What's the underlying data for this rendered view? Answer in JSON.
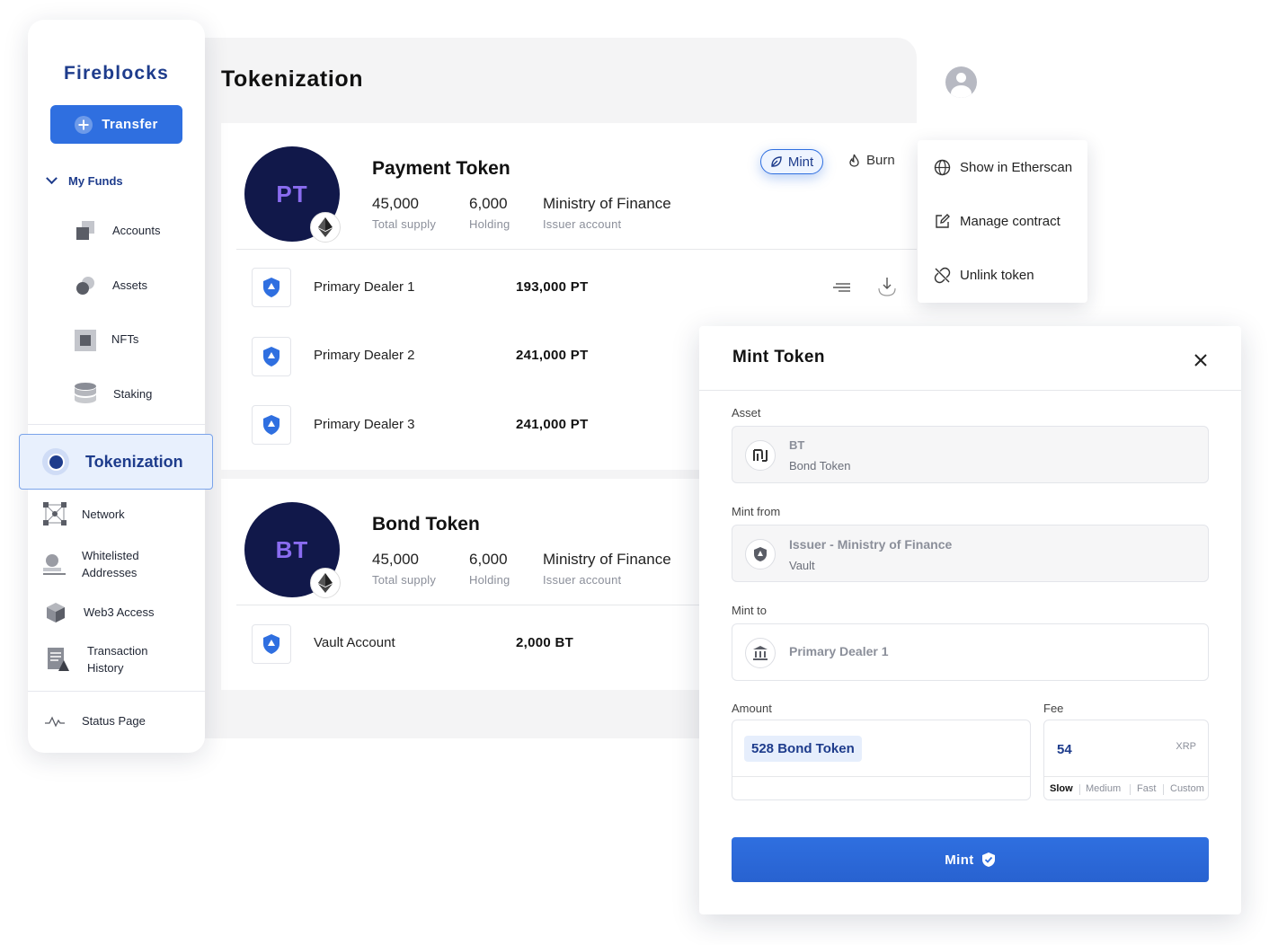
{
  "app": {
    "brand": "Fireblocks"
  },
  "sidebar": {
    "transfer_label": "Transfer",
    "group_label": "My Funds",
    "fund_items": [
      {
        "label": "Accounts",
        "icon": "accounts-icon"
      },
      {
        "label": "Assets",
        "icon": "assets-icon"
      },
      {
        "label": "NFTs",
        "icon": "nfts-icon"
      },
      {
        "label": "Staking",
        "icon": "staking-icon"
      }
    ],
    "active_label": "Tokenization",
    "items": [
      {
        "label": "Network",
        "icon": "network-icon"
      },
      {
        "label": "Whitelisted Addresses",
        "icon": "whitelist-icon"
      },
      {
        "label": "Web3 Access",
        "icon": "web3-icon"
      },
      {
        "label": "Transaction History",
        "icon": "history-icon"
      }
    ],
    "status_label": "Status Page"
  },
  "page": {
    "title": "Tokenization"
  },
  "tokens": [
    {
      "symbol": "PT",
      "name": "Payment Token",
      "total_supply": "45,000",
      "total_supply_label": "Total supply",
      "holding": "6,000",
      "holding_label": "Holding",
      "issuer": "Ministry of Finance",
      "issuer_label": "Issuer account",
      "holders": [
        {
          "name": "Primary Dealer 1",
          "amount": "193,000 PT"
        },
        {
          "name": "Primary Dealer 2",
          "amount": "241,000 PT"
        },
        {
          "name": "Primary Dealer 3",
          "amount": "241,000 PT"
        }
      ]
    },
    {
      "symbol": "BT",
      "name": "Bond Token",
      "total_supply": "45,000",
      "total_supply_label": "Total supply",
      "holding": "6,000",
      "holding_label": "Holding",
      "issuer": "Ministry of Finance",
      "issuer_label": "Issuer account",
      "holders": [
        {
          "name": "Vault Account",
          "amount": "2,000 BT"
        }
      ]
    }
  ],
  "actions": {
    "mint": "Mint",
    "burn": "Burn"
  },
  "context_menu": [
    {
      "label": "Show in Etherscan",
      "icon": "globe-icon"
    },
    {
      "label": "Manage contract",
      "icon": "edit-icon"
    },
    {
      "label": "Unlink token",
      "icon": "unlink-icon"
    }
  ],
  "modal": {
    "title": "Mint Token",
    "asset_label": "Asset",
    "asset_symbol": "BT",
    "asset_name": "Bond Token",
    "from_label": "Mint from",
    "from_name": "Issuer - Ministry of Finance",
    "from_sub": "Vault",
    "to_label": "Mint to",
    "to_name": "Primary Dealer 1",
    "amount_label": "Amount",
    "amount_value": "528 Bond Token",
    "fee_label": "Fee",
    "fee_value": "54",
    "fee_currency": "XRP",
    "fee_speeds": [
      "Slow",
      "Medium",
      "Fast",
      "Custom"
    ],
    "fee_selected": "Slow",
    "submit_label": "Mint"
  },
  "colors": {
    "accent": "#2f6fe0",
    "brand": "#1e3c8c",
    "token_bg": "#11184a",
    "token_text": "#8a6cf0"
  }
}
